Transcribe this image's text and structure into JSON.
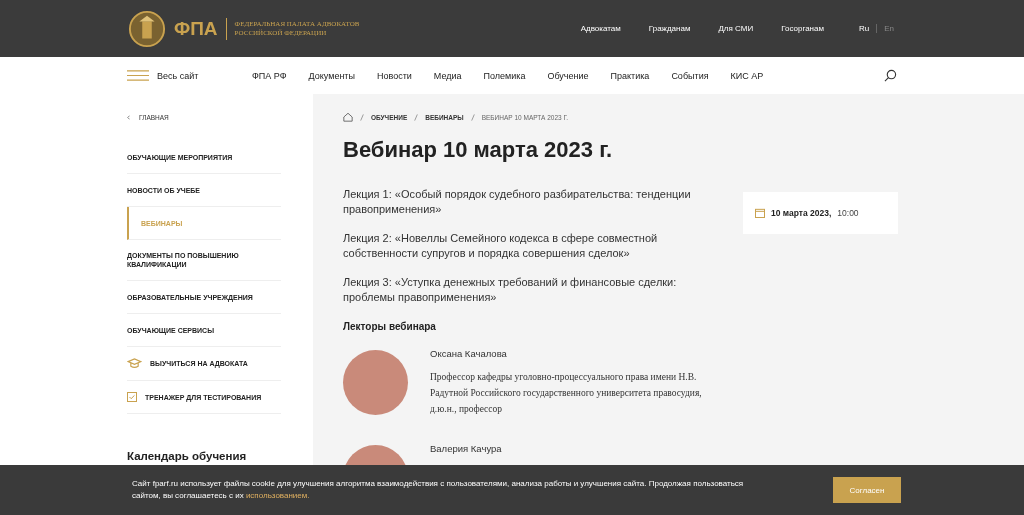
{
  "header": {
    "logo_text": "ФПА",
    "org_name": [
      "ФЕДЕРАЛЬНАЯ ПАЛАТА АДВОКАТОВ",
      "РОССИЙСКОЙ ФЕДЕРАЦИИ"
    ],
    "links": [
      "Адвокатам",
      "Гражданам",
      "Для СМИ",
      "Госорганам"
    ],
    "languages": [
      {
        "label": "Ru",
        "selected": true
      },
      {
        "label": "En",
        "selected": false
      }
    ]
  },
  "nav": {
    "all_site": "Весь сайт",
    "items": [
      "ФПА РФ",
      "Документы",
      "Новости",
      "Медиа",
      "Полемика",
      "Обучение",
      "Практика",
      "События",
      "КИС АР"
    ]
  },
  "sidebar": {
    "back": "ГЛАВНАЯ",
    "items": [
      {
        "label": "ОБУЧАЮЩИЕ МЕРОПРИЯТИЯ",
        "kind": "link",
        "selected": false
      },
      {
        "label": "НОВОСТИ ОБ УЧЕБЕ",
        "kind": "link",
        "selected": false
      },
      {
        "label": "ВЕБИНАРЫ",
        "kind": "link",
        "selected": true
      },
      {
        "label": "ДОКУМЕНТЫ ПО ПОВЫШЕНИЮ КВАЛИФИКАЦИИ",
        "kind": "link",
        "selected": false
      },
      {
        "label": "ОБРАЗОВАТЕЛЬНЫЕ УЧРЕЖДЕНИЯ",
        "kind": "link",
        "selected": false
      },
      {
        "label": "ОБУЧАЮЩИЕ СЕРВИСЫ",
        "kind": "link",
        "selected": false
      },
      {
        "label": "ВЫУЧИТЬСЯ НА АДВОКАТА",
        "kind": "cap",
        "selected": false
      },
      {
        "label": "ТРЕНАЖЕР ДЛЯ ТЕСТИРОВАНИЯ",
        "kind": "check",
        "selected": false
      }
    ],
    "calendar_title": "Календарь обучения"
  },
  "breadcrumbs": [
    "ОБУЧЕНИЕ",
    "ВЕБИНАРЫ",
    "ВЕБИНАР 10 МАРТА 2023 Г."
  ],
  "title": "Вебинар 10 марта 2023 г.",
  "lectures": [
    "Лекция 1: «Особый порядок судебного разбирательства: тенденции правоприменения»",
    "Лекция 2: «Новеллы Семейного кодекса в сфере совместной собственности супругов и порядка совершения сделок»",
    "Лекция 3: «Уступка денежных требований и финансовые сделки: проблемы правоприменения»"
  ],
  "event_date": {
    "date": "10 марта 2023,",
    "time": "10:00"
  },
  "lecturers_title": "Лекторы вебинара",
  "lecturers": [
    {
      "name": "Оксана Качалова",
      "bio": "Профессор кафедры уголовно-процессуального права имени Н.В. Радутной Российского государственного университета правосудия, д.ю.н., профессор"
    },
    {
      "name": "Валерия Качура"
    }
  ],
  "cookie": {
    "text": "Сайт fparf.ru использует файлы cookie для улучшения алгоритма взаимодействия с пользователями, анализа работы и улучшения сайта. Продолжая пользоваться сайтом, вы соглашаетесь с их ",
    "link": "использованием.",
    "button": "Согласен"
  }
}
